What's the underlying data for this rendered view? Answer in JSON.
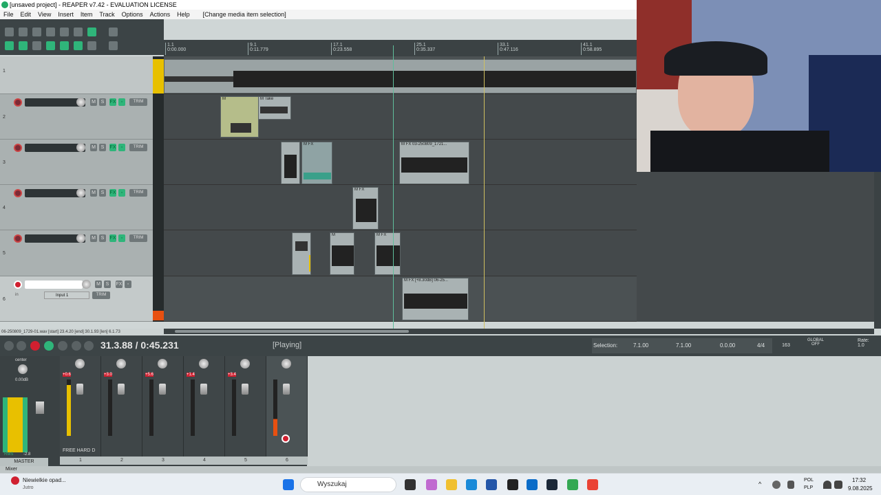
{
  "window": {
    "title": "[unsaved project] - REAPER v7.42 - EVALUATION LICENSE"
  },
  "menu": [
    "File",
    "Edit",
    "View",
    "Insert",
    "Item",
    "Track",
    "Options",
    "Actions",
    "Help",
    "[Change media item selection]"
  ],
  "ruler": {
    "marks": [
      {
        "bar": "1.1",
        "time": "0:00.000"
      },
      {
        "bar": "9.1",
        "time": "0:11.779"
      },
      {
        "bar": "17.1",
        "time": "0:23.558"
      },
      {
        "bar": "25.1",
        "time": "0:35.337"
      },
      {
        "bar": "33.1",
        "time": "0:47.116"
      },
      {
        "bar": "41.1",
        "time": "0:58.895"
      }
    ]
  },
  "tracks": [
    {
      "num": "1"
    },
    {
      "num": "2"
    },
    {
      "num": "3"
    },
    {
      "num": "4"
    },
    {
      "num": "5"
    },
    {
      "num": "6",
      "input": "Input 1",
      "in_label": "in"
    }
  ],
  "items": {
    "take_label": "Take",
    "item_a": "03-250809_1721...",
    "item_b": "[+8.30dB] 06-25..."
  },
  "status_line": "06-250809_1729-01.wav [start] 23.4.20 [end] 30.1.93 [len] 6.1.73",
  "transport": {
    "time": "31.3.88 / 0:45.231",
    "state": "[Playing]"
  },
  "selection": {
    "label": "Selection:",
    "start": "7.1.00",
    "end": "7.1.00",
    "length": "0.0.00",
    "timesig": "4/4",
    "bpm": "163",
    "global": "GLOBAL",
    "global_state": "OFF",
    "rate_label": "Rate:",
    "rate": "1.0"
  },
  "mixer": {
    "master_label": "MASTER",
    "center": "center",
    "master_vol": "0.00dB",
    "master_rms": "RMS",
    "master_rms_val": "-2.8",
    "strips": [
      {
        "num": "1",
        "peak": "+0.6",
        "name": "FREE HARD D"
      },
      {
        "num": "2",
        "peak": "+3.0",
        "name": ""
      },
      {
        "num": "3",
        "peak": "+5.6",
        "name": ""
      },
      {
        "num": "4",
        "peak": "+1.4",
        "name": ""
      },
      {
        "num": "5",
        "peak": "+3.4",
        "name": ""
      },
      {
        "num": "6",
        "peak": "",
        "name": ""
      }
    ],
    "footer_label": "Mixer"
  },
  "taskbar": {
    "weather_title": "Niewielkie opad...",
    "weather_sub": "Jutro",
    "search_placeholder": "Wyszukaj",
    "lang1": "POL",
    "lang2": "PLP",
    "clock_time": "17:32",
    "clock_date": "9.08.2025"
  },
  "colors": {
    "accent_green": "#2fb57a",
    "record_red": "#d02030",
    "arrange_bg": "#44494b"
  }
}
